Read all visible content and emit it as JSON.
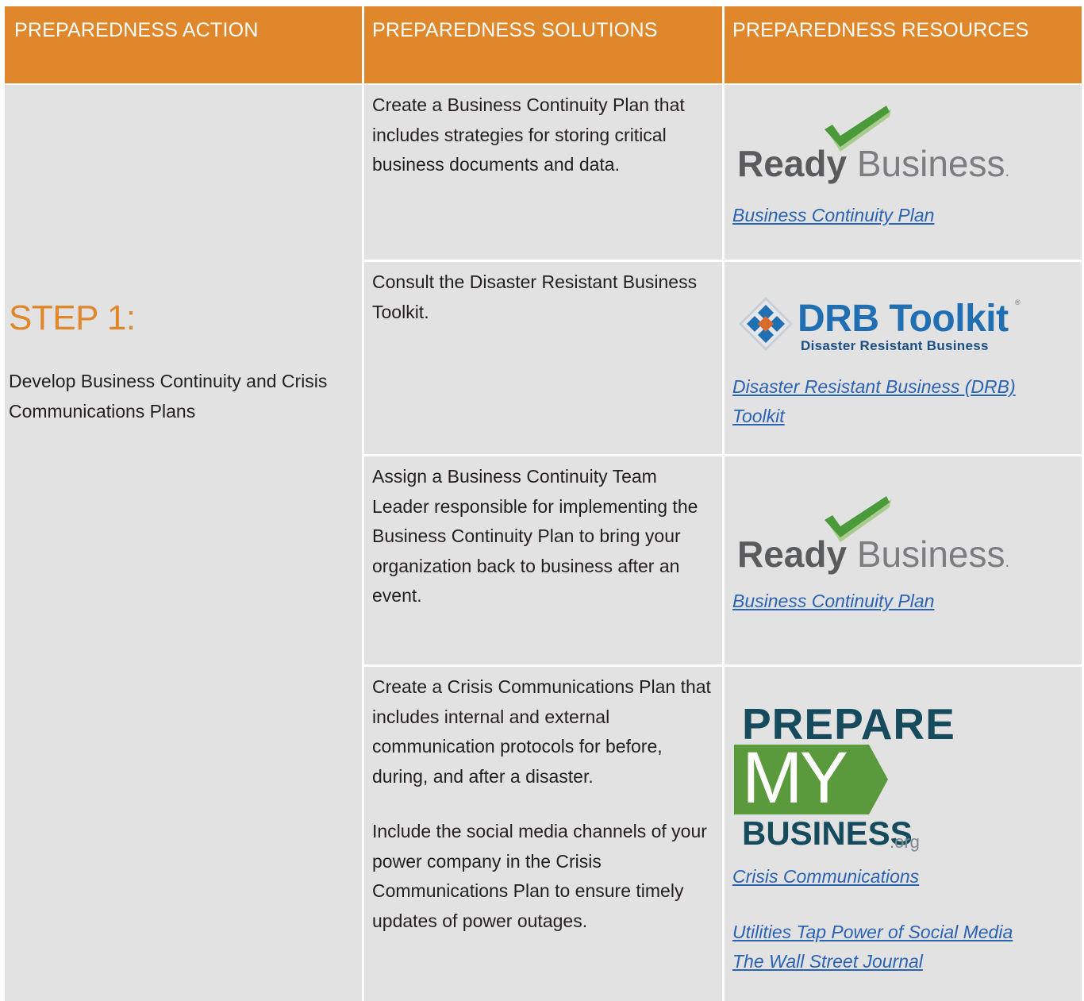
{
  "header": {
    "col1": "PREPAREDNESS ACTION",
    "col2": "PREPAREDNESS SOLUTIONS",
    "col3": "PREPAREDNESS RESOURCES"
  },
  "step": {
    "title": "STEP 1:",
    "description": "Develop Business Continuity and Crisis Communications Plans"
  },
  "rows": [
    {
      "solution": "Create a Business Continuity Plan that includes strategies for storing critical business documents and data.",
      "logo": {
        "word1": "Ready",
        "word2": "Business",
        "word2_suffix": "."
      },
      "link": "Business Continuity Plan"
    },
    {
      "solution": "Consult the Disaster Resistant Business Toolkit.",
      "logo": {
        "title": "DRB Toolkit",
        "subtitle": "Disaster Resistant Business",
        "mark": "®"
      },
      "link": "Disaster Resistant Business (DRB) Toolkit"
    },
    {
      "solution": "Assign a Business Continuity Team Leader responsible for implementing the Business Continuity Plan to bring your organization back to business after an event.",
      "logo": {
        "word1": "Ready",
        "word2": "Business",
        "word2_suffix": "."
      },
      "link": "Business Continuity Plan"
    },
    {
      "solution_p1": "Create a Crisis Communications Plan that includes internal and external communication protocols for before, during, and after a disaster.",
      "solution_p2": "Include the social media channels of your power company in the Crisis Communications Plan to ensure timely updates of power outages.",
      "logo": {
        "line1": "PREPARE",
        "line2": "MY",
        "line3": "BUSINESS",
        "suffix": ".org"
      },
      "link1": "Crisis Communications",
      "link2_line1": "Utilities Tap Power of Social Media",
      "link2_line2": "The Wall Street Journal"
    }
  ],
  "colors": {
    "header": "#e0872b",
    "cell": "#e3e2e2",
    "link": "#2a63b4",
    "check_dark": "#4a9a3a",
    "check_light": "#a9cc8e",
    "pmb_green": "#5a9a3c",
    "pmb_navy": "#154b5c",
    "drb_blue": "#1f6fb2",
    "drb_orange": "#d86a2a"
  }
}
